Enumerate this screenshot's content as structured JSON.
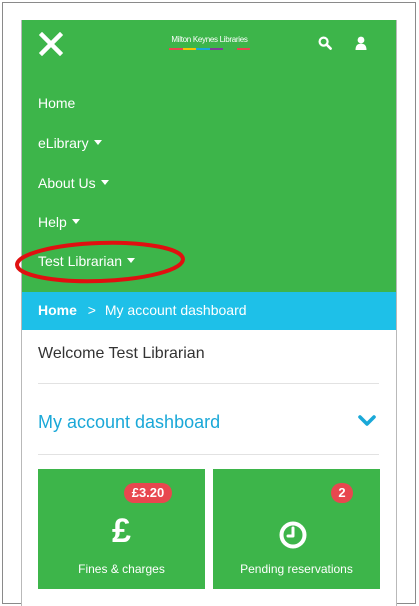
{
  "brand": {
    "logo_text": "Milton Keynes Libraries",
    "logo_colors": [
      "#e8474f",
      "#f6c400",
      "#1aa8d8",
      "#7f3f98",
      "#3db54a",
      "#e8474f"
    ]
  },
  "header": {
    "close_icon": "close-icon",
    "search_icon": "search-icon",
    "user_icon": "user-icon"
  },
  "nav": {
    "items": [
      {
        "label": "Home",
        "dropdown": false
      },
      {
        "label": "eLibrary",
        "dropdown": true
      },
      {
        "label": "About Us",
        "dropdown": true
      },
      {
        "label": "Help",
        "dropdown": true
      },
      {
        "label": "Test Librarian",
        "dropdown": true
      }
    ]
  },
  "breadcrumb": {
    "home": "Home",
    "separator": ">",
    "current": "My account dashboard"
  },
  "welcome": "Welcome Test Librarian",
  "dashboard": {
    "title": "My account dashboard",
    "chevron_icon": "chevron-down-icon"
  },
  "tiles": [
    {
      "badge": "£3.20",
      "icon_glyph": "£",
      "icon": "pound-icon",
      "label": "Fines & charges"
    },
    {
      "badge": "2",
      "icon": "clock-icon",
      "label": "Pending reservations"
    }
  ],
  "colors": {
    "nav_green": "#3db54a",
    "breadcrumb_blue": "#1ec0e8",
    "accent_blue": "#1aa8d8",
    "badge_red": "#e8474f",
    "annotation_red": "#e01010"
  }
}
